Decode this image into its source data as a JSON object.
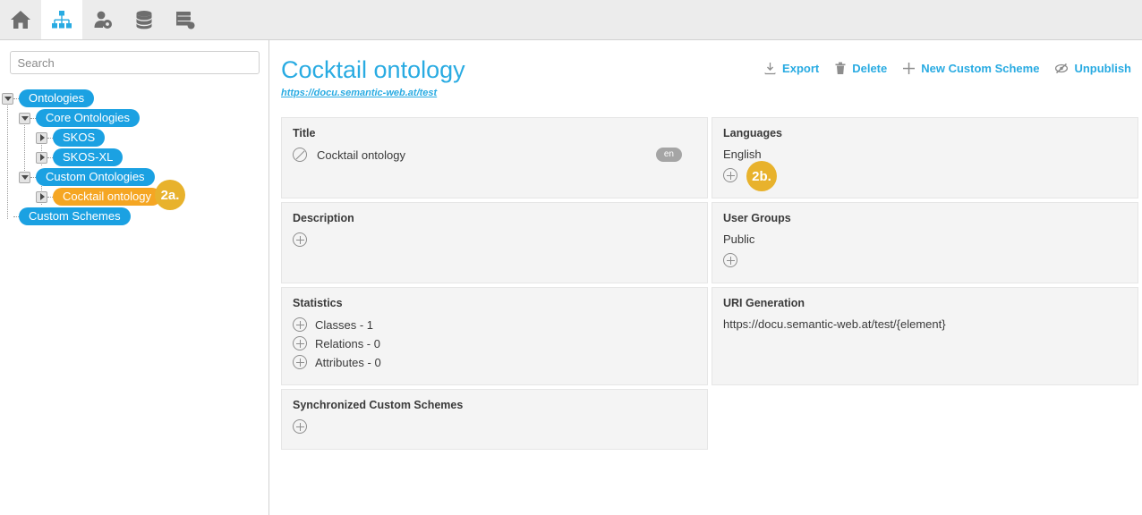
{
  "toolbar": {
    "items": [
      {
        "name": "home-icon",
        "label": "Home"
      },
      {
        "name": "hierarchy-icon",
        "label": "Ontologies",
        "active": true
      },
      {
        "name": "user-settings-icon",
        "label": "User Management"
      },
      {
        "name": "database-icon",
        "label": "Data"
      },
      {
        "name": "server-icon",
        "label": "Server"
      }
    ]
  },
  "sidebar": {
    "search": {
      "placeholder": "Search",
      "value": ""
    },
    "tree": [
      {
        "label": "Ontologies",
        "depth": 0,
        "toggle": "open",
        "selected": false
      },
      {
        "label": "Core Ontologies",
        "depth": 1,
        "toggle": "open",
        "selected": false
      },
      {
        "label": "SKOS",
        "depth": 2,
        "toggle": "closed",
        "selected": false
      },
      {
        "label": "SKOS-XL",
        "depth": 2,
        "toggle": "closed",
        "selected": false
      },
      {
        "label": "Custom Ontologies",
        "depth": 1,
        "toggle": "open",
        "selected": false
      },
      {
        "label": "Cocktail ontology",
        "depth": 2,
        "toggle": "closed",
        "selected": true
      },
      {
        "label": "Custom Schemes",
        "depth": 0,
        "toggle": "none",
        "selected": false
      }
    ],
    "annotation": {
      "label": "2a."
    }
  },
  "header": {
    "title": "Cocktail ontology",
    "url": "https://docu.semantic-web.at/test",
    "actions": [
      {
        "label": "Export",
        "icon": "download-icon"
      },
      {
        "label": "Delete",
        "icon": "trash-icon"
      },
      {
        "label": "New Custom Scheme",
        "icon": "plus-icon"
      },
      {
        "label": "Unpublish",
        "icon": "eye-slash-icon"
      }
    ]
  },
  "panels": {
    "title": {
      "heading": "Title",
      "value": "Cocktail ontology",
      "lang_badge": "en"
    },
    "languages": {
      "heading": "Languages",
      "value": "English",
      "annotation": "2b."
    },
    "description": {
      "heading": "Description"
    },
    "user_groups": {
      "heading": "User Groups",
      "value": "Public"
    },
    "statistics": {
      "heading": "Statistics",
      "items": [
        {
          "label": "Classes - 1"
        },
        {
          "label": "Relations - 0"
        },
        {
          "label": "Attributes - 0"
        }
      ]
    },
    "uri_generation": {
      "heading": "URI Generation",
      "value": "https://docu.semantic-web.at/test/{element}"
    },
    "synchronized_custom_schemes": {
      "heading": "Synchronized Custom Schemes"
    }
  },
  "colors": {
    "accent": "#29abe2",
    "tree_node": "#1ba1e2",
    "selected_node": "#f5a623",
    "annotation": "#e8b22c",
    "panel_bg": "#f4f4f4",
    "toolbar_bg": "#ececec"
  }
}
